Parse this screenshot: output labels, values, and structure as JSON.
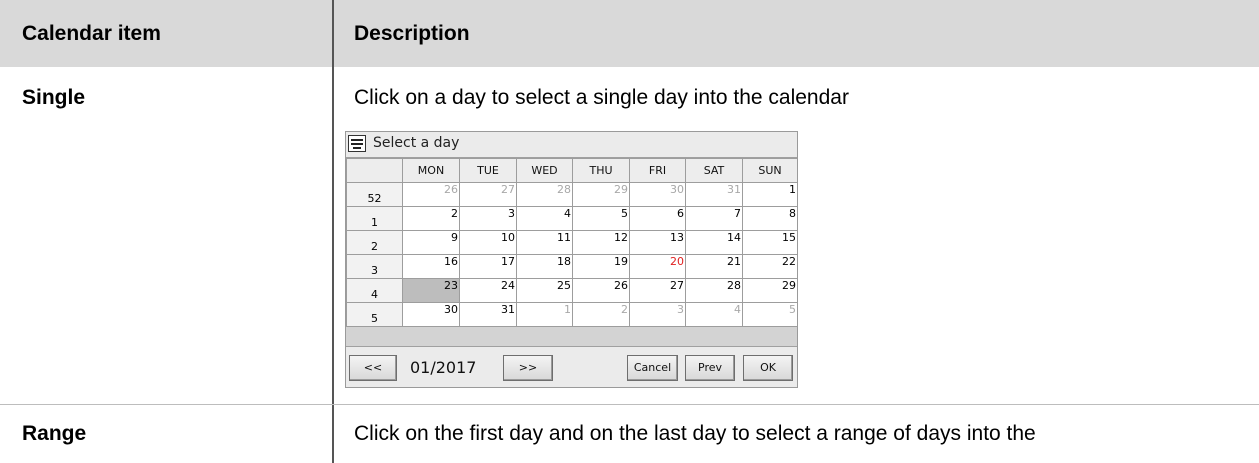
{
  "table": {
    "headers": [
      "Calendar item",
      "Description"
    ],
    "rows": [
      {
        "item": "Single",
        "description": "Click on a day to select a single day into the calendar"
      },
      {
        "item": "Range",
        "description": "Click on the first day and on the last day to select a range of days into the"
      }
    ]
  },
  "calendar": {
    "title": "Select a day",
    "icon": "keyboard-icon",
    "weekdays": [
      "MON",
      "TUE",
      "WED",
      "THU",
      "FRI",
      "SAT",
      "SUN"
    ],
    "weeks": [
      {
        "week": "52",
        "days": [
          "26",
          "27",
          "28",
          "29",
          "30",
          "31",
          "1"
        ]
      },
      {
        "week": "1",
        "days": [
          "2",
          "3",
          "4",
          "5",
          "6",
          "7",
          "8"
        ]
      },
      {
        "week": "2",
        "days": [
          "9",
          "10",
          "11",
          "12",
          "13",
          "14",
          "15"
        ]
      },
      {
        "week": "3",
        "days": [
          "16",
          "17",
          "18",
          "19",
          "20",
          "21",
          "22"
        ]
      },
      {
        "week": "4",
        "days": [
          "23",
          "24",
          "25",
          "26",
          "27",
          "28",
          "29"
        ]
      },
      {
        "week": "5",
        "days": [
          "30",
          "31",
          "1",
          "2",
          "3",
          "4",
          "5"
        ]
      }
    ],
    "today": "20",
    "selected": "23",
    "month_label": "01/2017",
    "buttons": {
      "prev_month": "<<",
      "next_month": ">>",
      "cancel": "Cancel",
      "prev": "Prev",
      "ok": "OK"
    },
    "colors": {
      "today": "#e02020",
      "selected_bg": "#bdbdbd",
      "other_month": "#a8a8a8"
    }
  }
}
